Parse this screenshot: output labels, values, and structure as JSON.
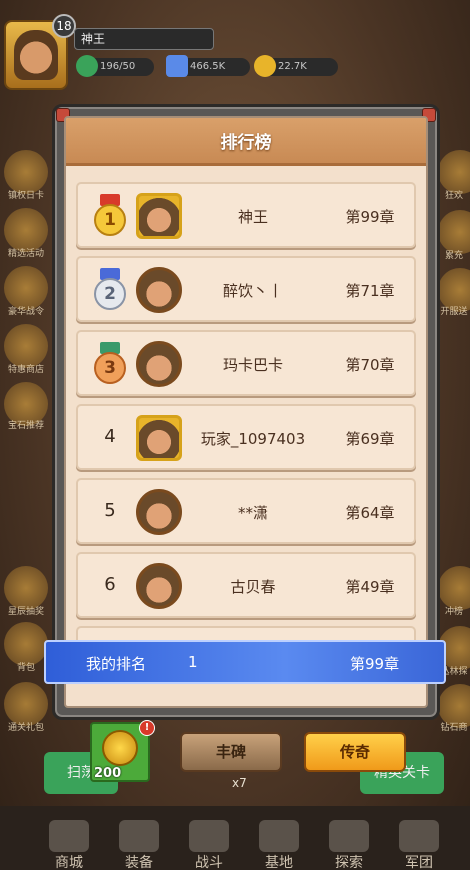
{
  "player": {
    "name": "神王",
    "level": "18",
    "energy": "196/50",
    "gems": "466.5K",
    "gold": "22.7K"
  },
  "side_left": [
    "镇权日卡",
    "精选活动",
    "豪华战令",
    "特惠商店",
    "宝石推荐",
    "星辰抽奖",
    "背包",
    "通关礼包"
  ],
  "side_right": [
    "狂欢",
    "累充",
    "开服送",
    "冲榜",
    "丛林探",
    "钻石商"
  ],
  "background_buttons": {
    "sweep": "扫荡",
    "elite": "精英关卡",
    "energy_cost": "x7"
  },
  "bottom_nav": [
    "商城",
    "装备",
    "战斗",
    "基地",
    "探索",
    "军团"
  ],
  "modal": {
    "title": "排行榜",
    "rows": [
      {
        "rank": "1",
        "name": "神王",
        "chapter": "第99章"
      },
      {
        "rank": "2",
        "name": "醉饮丶丨",
        "chapter": "第71章"
      },
      {
        "rank": "3",
        "name": "玛卡巴卡",
        "chapter": "第70章"
      },
      {
        "rank": "4",
        "name": "玩家_1097403",
        "chapter": "第69章"
      },
      {
        "rank": "5",
        "name": "**潇",
        "chapter": "第64章"
      },
      {
        "rank": "6",
        "name": "古贝春",
        "chapter": "第49章"
      }
    ],
    "my_rank": {
      "label": "我的排名",
      "value": "1",
      "chapter": "第99章"
    },
    "tabs": {
      "monument": "丰碑",
      "legend": "传奇"
    },
    "reward": {
      "count": "200",
      "alert": "!"
    }
  },
  "colors": {
    "accent_blue": "#3a66d8",
    "legend_gold": "#f5b22a",
    "panel_cream": "#f3e0cc"
  }
}
